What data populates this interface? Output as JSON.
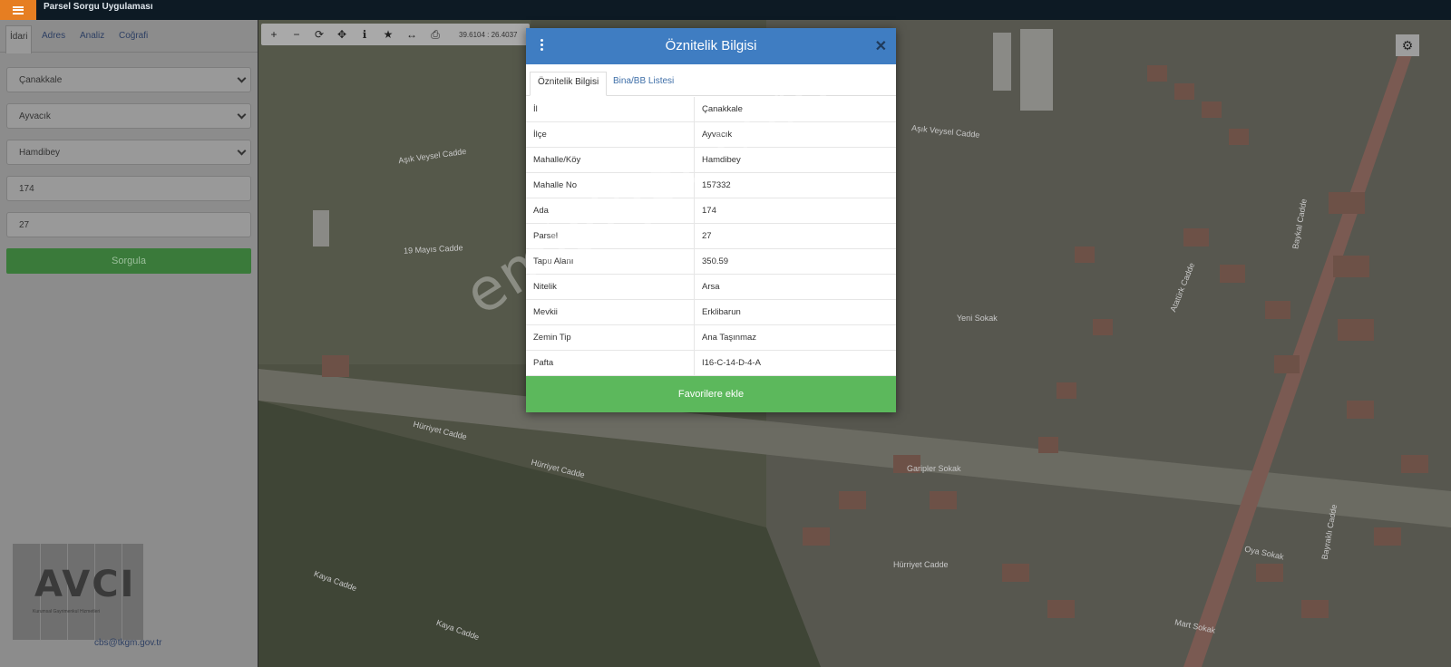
{
  "topbar": {
    "app_title": "Parsel Sorgu Uygulaması"
  },
  "sidebar": {
    "tabs": [
      "İdari",
      "Adres",
      "Analiz",
      "Coğrafi"
    ],
    "province": "Çanakkale",
    "district": "Ayvacık",
    "neighborhood": "Hamdibey",
    "ada": "174",
    "parsel": "27",
    "query_label": "Sorgula",
    "logo_text": "AVCI",
    "logo_tagline": "Kurumsal Gayrimenkul Hizmetleri",
    "footer_email": "cbs@tkgm.gov.tr"
  },
  "map": {
    "coords": "39.6104 : 26.4037",
    "streets": [
      "Aşık Veysel Cadde",
      "Aşık Veysel Cadde",
      "19 Mayıs Cadde",
      "Hürriyet Cadde",
      "Hürriyet Cadde",
      "Hürriyet Cadde",
      "Kaya Cadde",
      "Kaya Cadde",
      "Atatürk Cadde",
      "Oya Sokak",
      "Garipler Sokak",
      "Yeni Sokak",
      "Baykal Cadde",
      "Bayraklı Cadde",
      "Mart Sokak"
    ]
  },
  "modal": {
    "title": "Öznitelik Bilgisi",
    "tab_active": "Öznitelik Bilgisi",
    "tab_other": "Bina/BB Listesi",
    "rows": [
      {
        "k": "İl",
        "v": "Çanakkale"
      },
      {
        "k": "İlçe",
        "v": "Ayvacık"
      },
      {
        "k": "Mahalle/Köy",
        "v": "Hamdibey"
      },
      {
        "k": "Mahalle No",
        "v": "157332"
      },
      {
        "k": "Ada",
        "v": "174"
      },
      {
        "k": "Parsel",
        "v": "27"
      },
      {
        "k": "Tapu Alanı",
        "v": "350.59"
      },
      {
        "k": "Nitelik",
        "v": "Arsa"
      },
      {
        "k": "Mevkii",
        "v": "Erklibarun"
      },
      {
        "k": "Zemin Tip",
        "v": "Ana Taşınmaz"
      },
      {
        "k": "Pafta",
        "v": "I16-C-14-D-4-A"
      }
    ],
    "favorite_label": "Favorilere ekle"
  },
  "watermark": "emlakjet.com"
}
